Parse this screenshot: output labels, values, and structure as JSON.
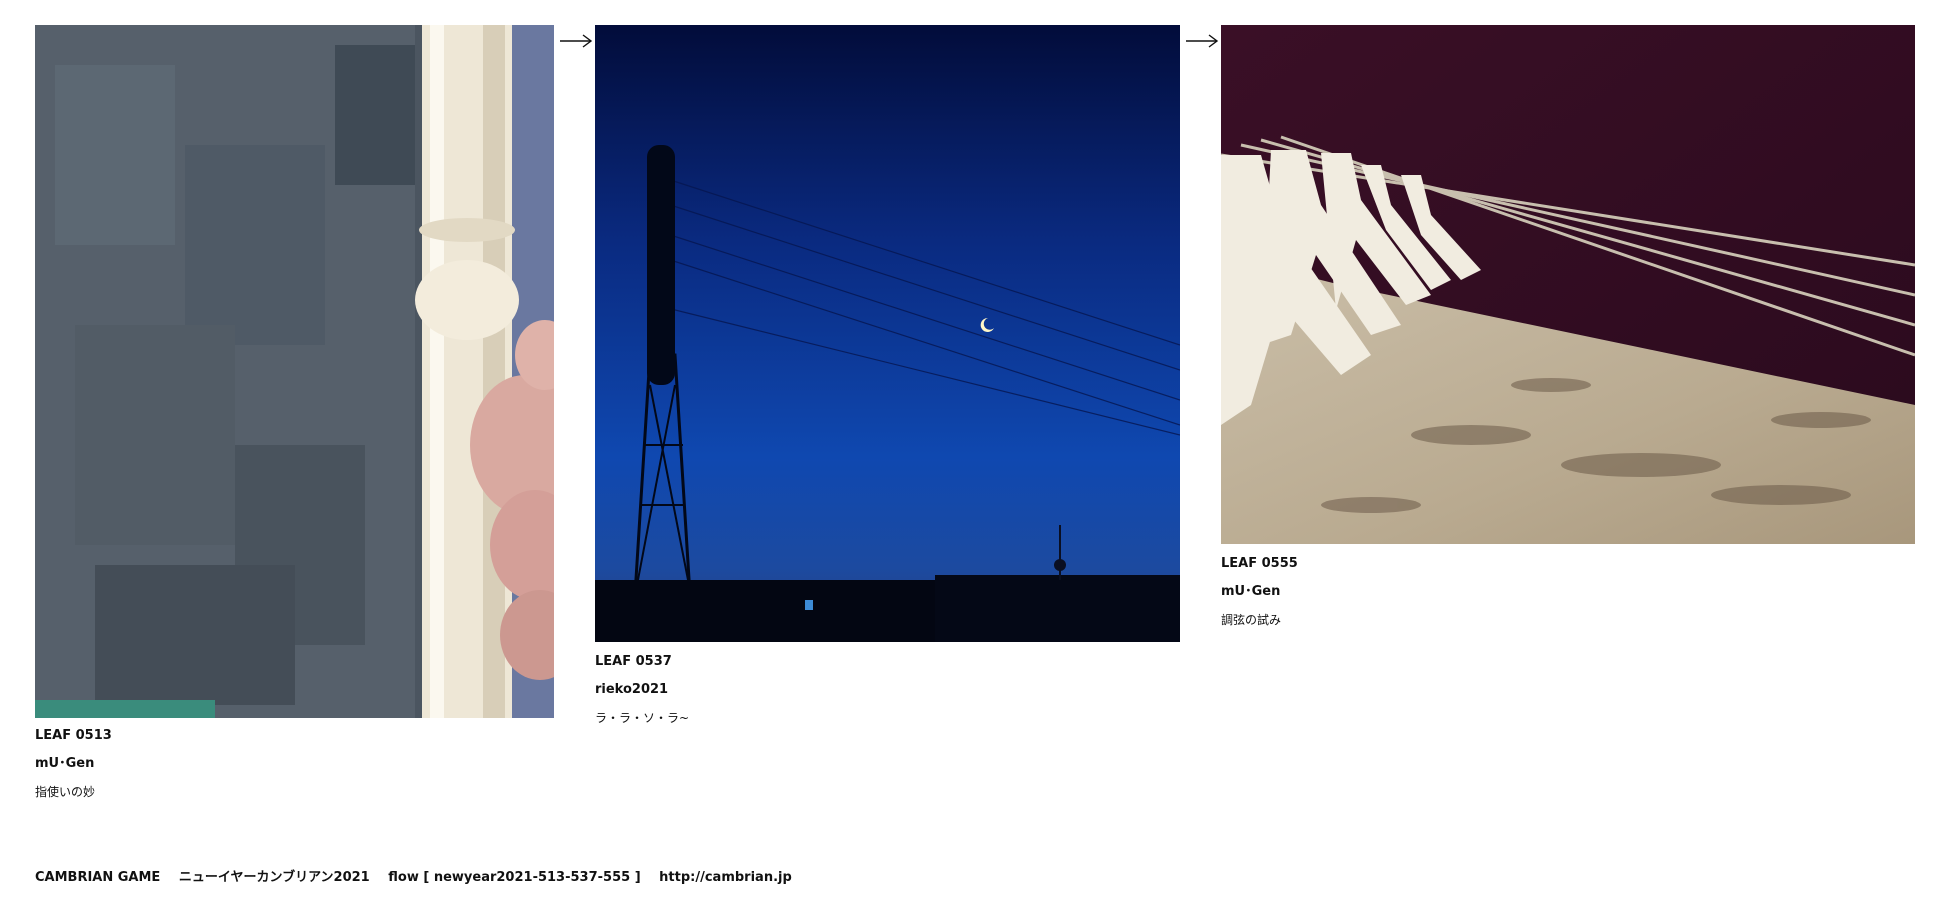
{
  "cards": [
    {
      "id": "LEAF 0513",
      "author": "mU･Gen",
      "title": "指使いの妙",
      "image_subject": "recorder-hand-photo"
    },
    {
      "id": "LEAF 0537",
      "author": "rieko2021",
      "title": "ラ・ラ・ソ・ラ~",
      "image_subject": "night-sky-crescent-moon-photo"
    },
    {
      "id": "LEAF 0555",
      "author": "mU･Gen",
      "title": "調弦の試み",
      "image_subject": "koto-bridges-strings-photo"
    }
  ],
  "arrows": [
    "arrow-right-icon",
    "arrow-right-icon"
  ],
  "footer": {
    "brand": "CAMBRIAN GAME",
    "series": "ニューイヤーカンブリアン2021",
    "flow": "flow [ newyear2021-513-537-555 ]",
    "url": "http://cambrian.jp"
  }
}
